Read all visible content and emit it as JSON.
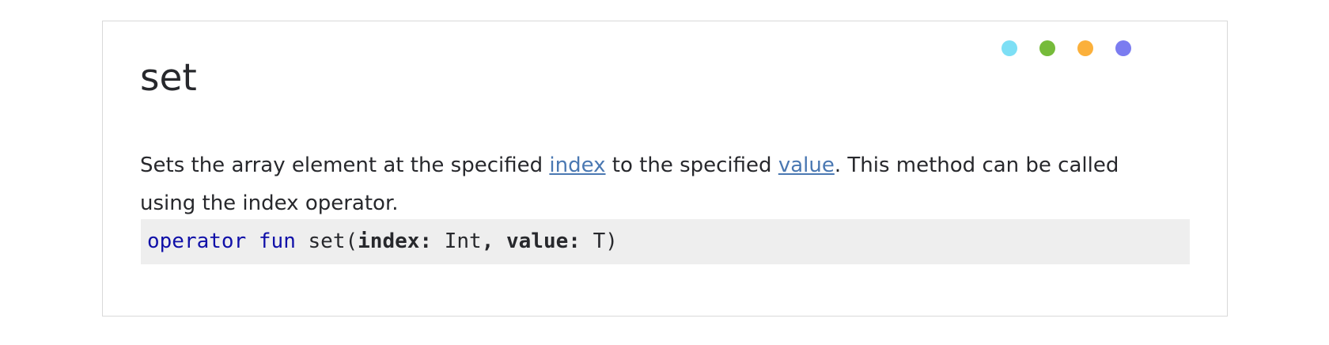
{
  "colors": {
    "dot_1": "#7ddff5",
    "dot_2": "#76bb3a",
    "dot_3": "#fbb03b",
    "dot_4": "#7b7cf0",
    "link": "#4a78b2",
    "keyword": "#1010a8",
    "code_background": "#eeeeee"
  },
  "platform_dots": [
    "cyan",
    "green",
    "orange",
    "purple"
  ],
  "doc": {
    "title": "set",
    "description": {
      "part1": "Sets the array element at the specified ",
      "link1": "index",
      "part2": " to the specified ",
      "link2": "value",
      "part3": ". This method can be called using the index operator."
    }
  },
  "signature": {
    "kw1": "operator",
    "kw2": "fun",
    "name": "set(",
    "param1_name": "index:",
    "param1_type": "Int",
    "comma": ",",
    "param2_name": "value:",
    "param2_type": "T",
    "close": ")"
  }
}
